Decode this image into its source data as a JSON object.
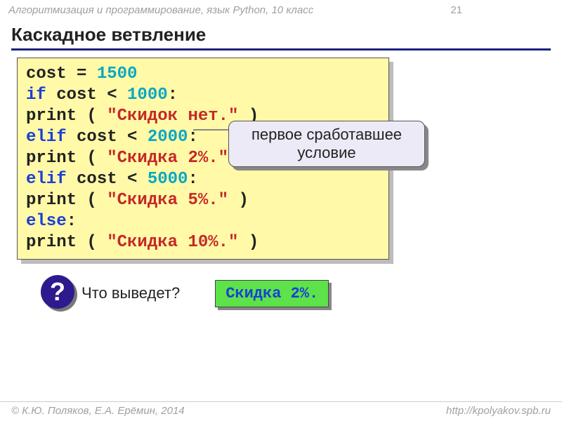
{
  "header": {
    "left": "Алгоритмизация и программирование, язык Python, 10 класс",
    "page": "21"
  },
  "title": "Каскадное ветвление",
  "code": {
    "l1_var": "cost",
    "l1_eq": " = ",
    "l1_num": "1500",
    "l2_if": "if",
    "l2_cond": " cost < ",
    "l2_num": "1000",
    "colon": ":",
    "l3_print": "  print ( ",
    "l3_str": "\"Скидок нет.\"",
    "l3_end": " )",
    "l4_elif": "elif",
    "l4_cond": " cost < ",
    "l4_num": "2000",
    "l5_print": "  print ( ",
    "l5_str": "\"Скидка 2%.\"",
    "l5_end": " )",
    "l6_elif": "elif",
    "l6_cond": " cost < ",
    "l6_num": "5000",
    "l7_print": "  print ( ",
    "l7_str": "\"Скидка 5%.\"",
    "l7_end": " )",
    "l8_else": "else",
    "l9_print": "  print ( ",
    "l9_str": "\"Скидка 10%.\"",
    "l9_end": " )"
  },
  "callout": {
    "line1": "первое сработавшее",
    "line2": "условие"
  },
  "question": {
    "mark": "?",
    "text": "Что выведет?"
  },
  "answer": "Скидка 2%.",
  "footer": {
    "left": "© К.Ю. Поляков, Е.А. Ерёмин, 2014",
    "right": "http://kpolyakov.spb.ru"
  }
}
